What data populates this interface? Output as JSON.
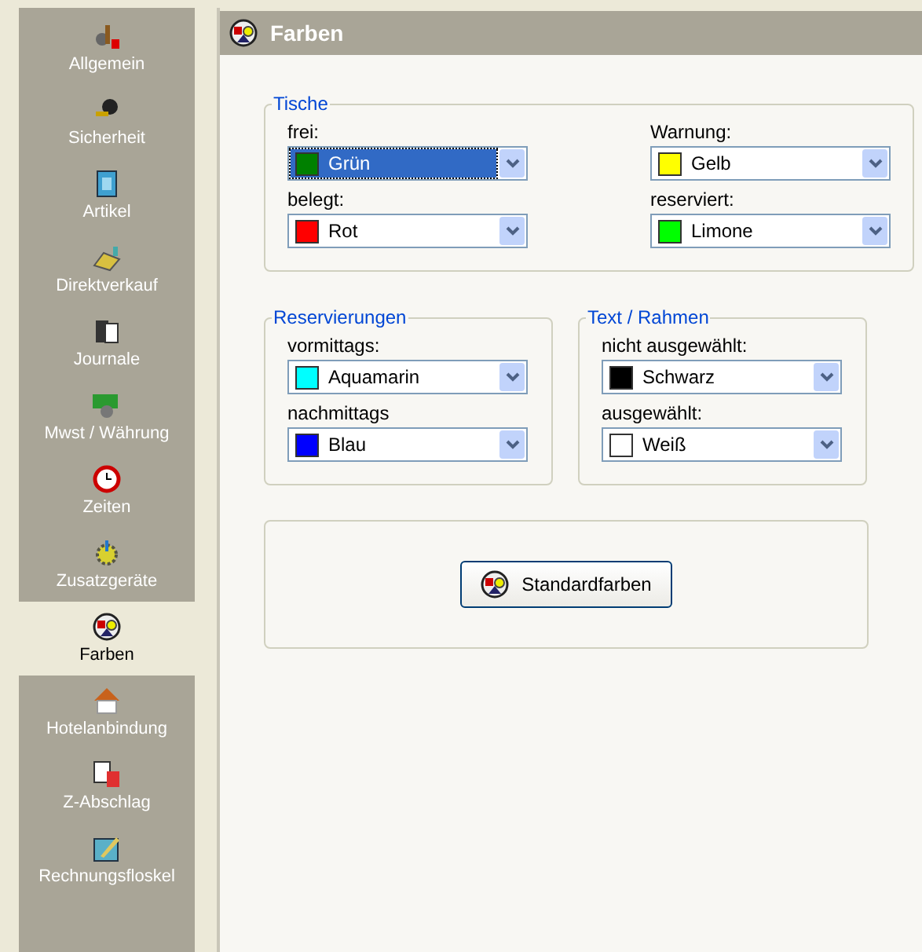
{
  "sidebar": {
    "items": [
      {
        "label": "Allgemein",
        "selected": false
      },
      {
        "label": "Sicherheit",
        "selected": false
      },
      {
        "label": "Artikel",
        "selected": false
      },
      {
        "label": "Direktverkauf",
        "selected": false
      },
      {
        "label": "Journale",
        "selected": false
      },
      {
        "label": "Mwst / Währung",
        "selected": false
      },
      {
        "label": "Zeiten",
        "selected": false
      },
      {
        "label": "Zusatzgeräte",
        "selected": false
      },
      {
        "label": "Farben",
        "selected": true
      },
      {
        "label": "Hotelanbindung",
        "selected": false
      },
      {
        "label": "Z-Abschlag",
        "selected": false
      },
      {
        "label": "Rechnungsfloskel",
        "selected": false
      }
    ]
  },
  "header": {
    "title": "Farben"
  },
  "groups": [
    {
      "title": "Tische",
      "fields": [
        {
          "label": "frei:",
          "value": "Grün",
          "color": "#008000",
          "focused": true
        },
        {
          "label": "Warnung:",
          "value": "Gelb",
          "color": "#ffff00",
          "focused": false
        },
        {
          "label": "belegt:",
          "value": "Rot",
          "color": "#ff0000",
          "focused": false
        },
        {
          "label": "reserviert:",
          "value": "Limone",
          "color": "#00ff00",
          "focused": false
        }
      ]
    },
    {
      "title": "Reservierungen",
      "fields": [
        {
          "label": "vormittags:",
          "value": "Aquamarin",
          "color": "#00ffff",
          "focused": false
        },
        {
          "label": "nachmittags",
          "value": "Blau",
          "color": "#0000ff",
          "focused": false
        }
      ]
    },
    {
      "title": "Text / Rahmen",
      "fields": [
        {
          "label": "nicht ausgewählt:",
          "value": "Schwarz",
          "color": "#000000",
          "focused": false
        },
        {
          "label": "ausgewählt:",
          "value": "Weiß",
          "color": "#ffffff",
          "focused": false
        }
      ]
    }
  ],
  "reset_button": {
    "label": "Standardfarben"
  }
}
